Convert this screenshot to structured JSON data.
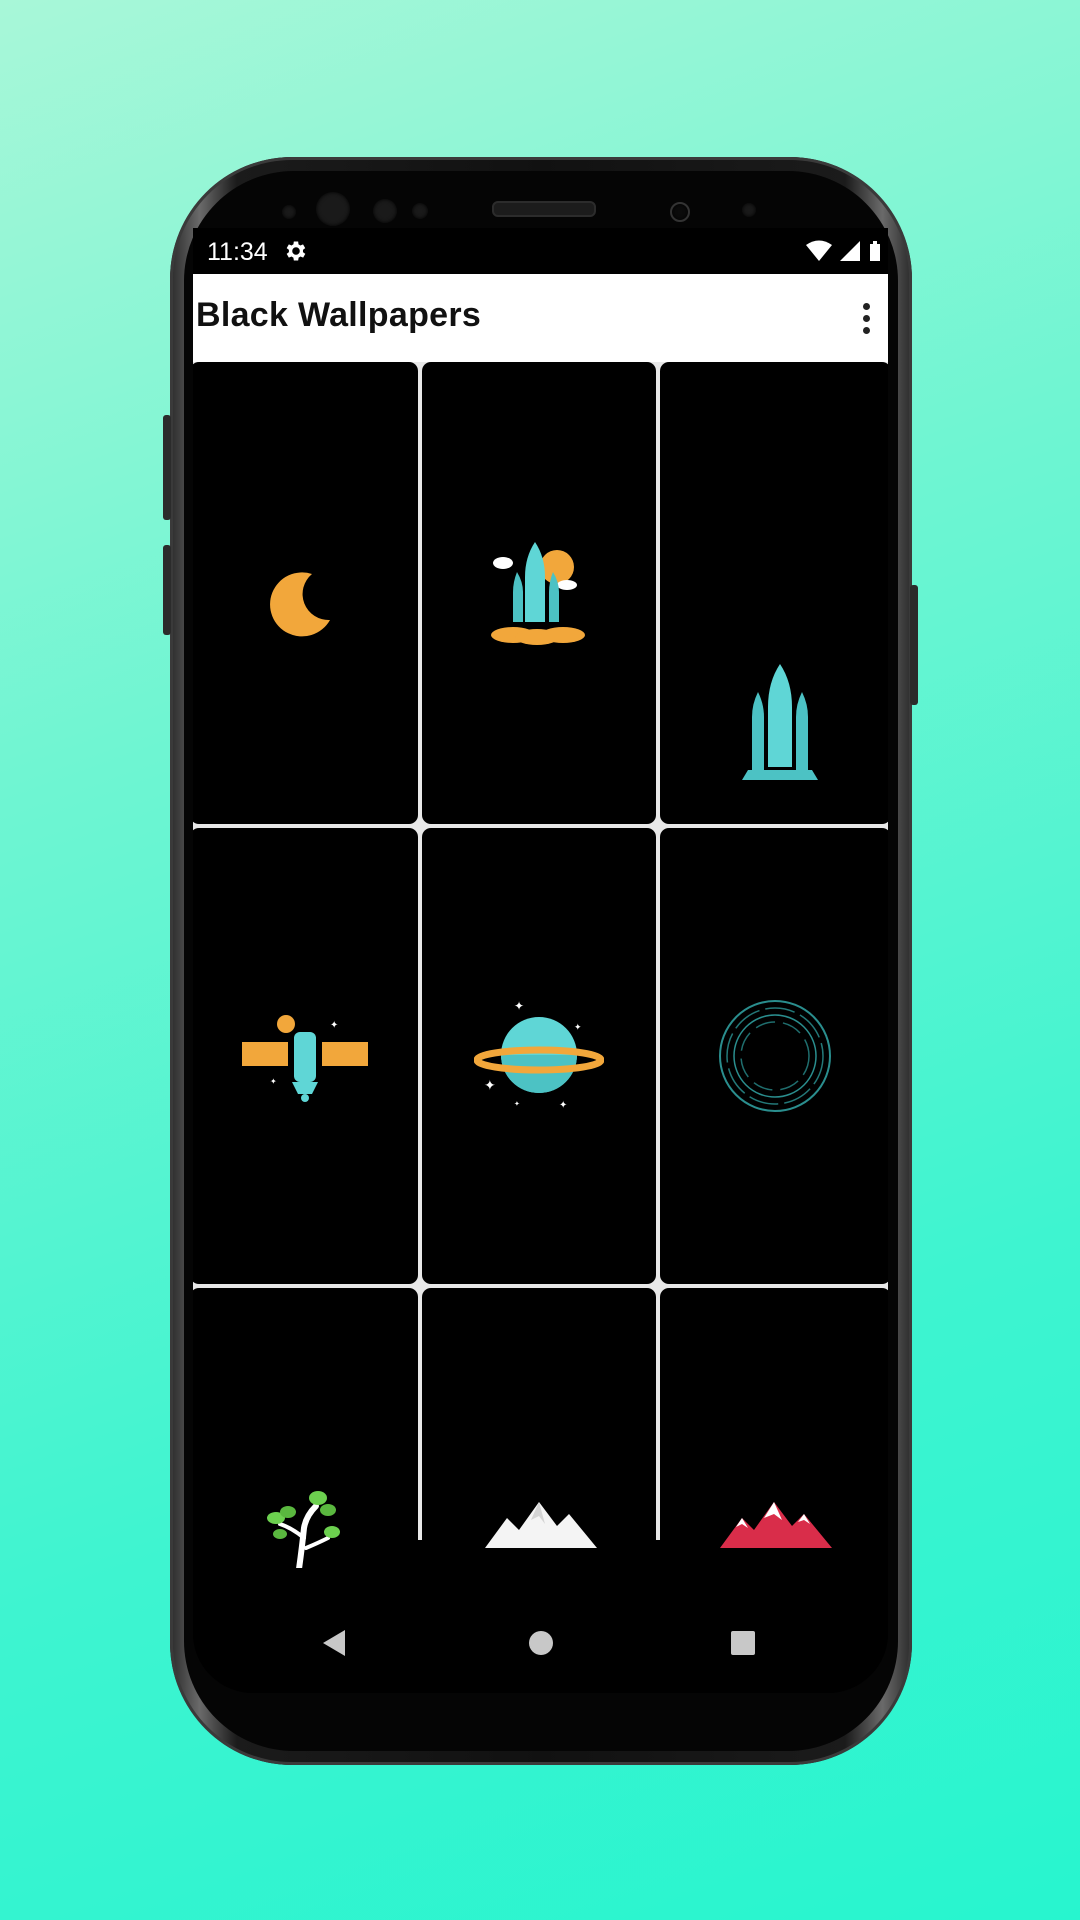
{
  "status_bar": {
    "time": "11:34",
    "icons": [
      "settings-gear-icon",
      "wifi-icon",
      "cell-signal-icon",
      "battery-icon"
    ]
  },
  "app_bar": {
    "title": "Black Wallpapers",
    "overflow_icon": "more-vert-icon"
  },
  "wallpapers": [
    {
      "name": "crescent moon",
      "icon": "moon-icon"
    },
    {
      "name": "rocket launch",
      "icon": "rocket-launch-icon"
    },
    {
      "name": "space shuttle",
      "icon": "space-shuttle-icon"
    },
    {
      "name": "satellite",
      "icon": "satellite-icon"
    },
    {
      "name": "ringed planet",
      "icon": "planet-icon"
    },
    {
      "name": "portal rings",
      "icon": "portal-rings-icon"
    },
    {
      "name": "sapling",
      "icon": "tree-sapling-icon"
    },
    {
      "name": "white mountains",
      "icon": "white-mountains-icon"
    },
    {
      "name": "red mountains",
      "icon": "red-mountains-icon"
    }
  ],
  "nav_bar": {
    "back_icon": "back-triangle-icon",
    "home_icon": "home-circle-icon",
    "recents_icon": "recents-square-icon"
  },
  "colors": {
    "background_top": "#a8f7d8",
    "background_bottom": "#27f5cf",
    "accent_orange": "#f2a73b",
    "accent_teal": "#5fd6d6",
    "mountain_red": "#d92d4a"
  }
}
